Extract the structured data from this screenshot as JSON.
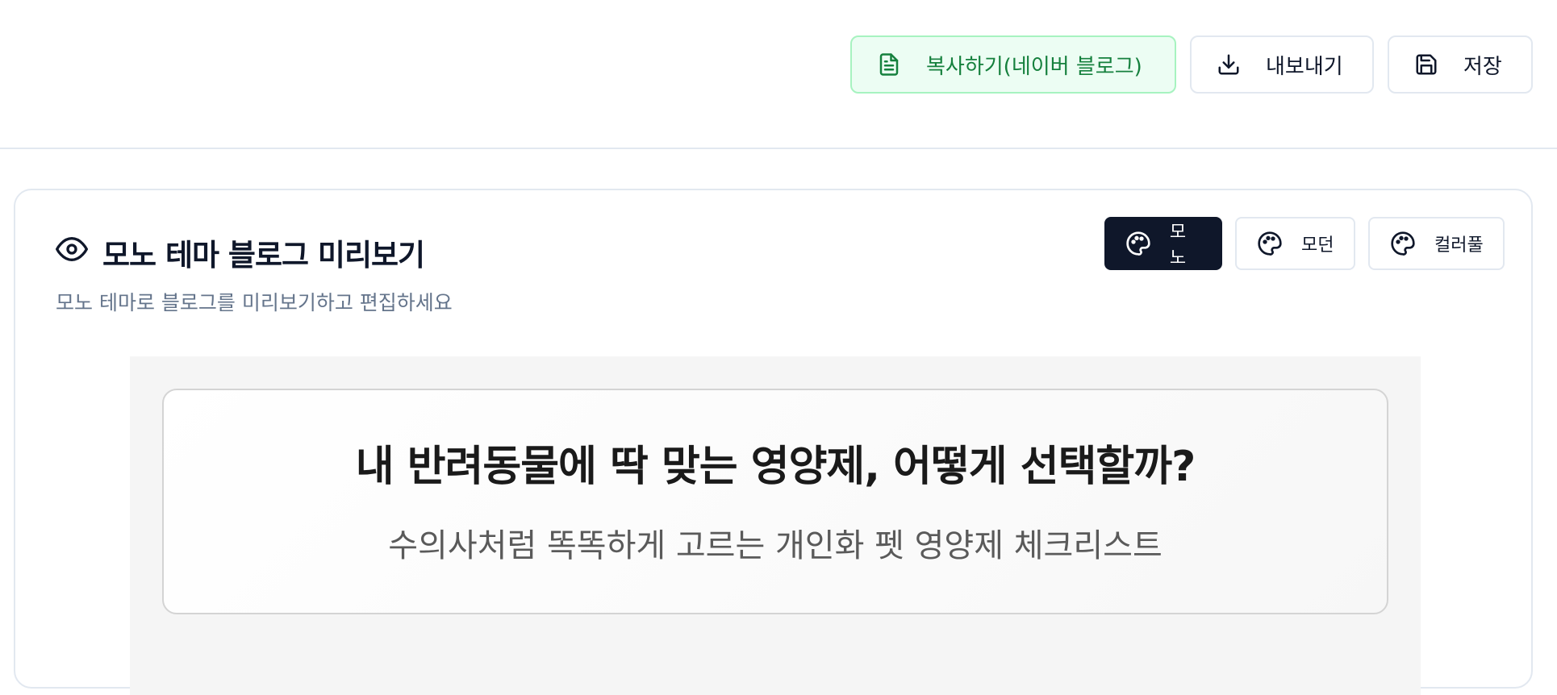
{
  "toolbar": {
    "copy_label": "복사하기(네이버 블로그)",
    "export_label": "내보내기",
    "save_label": "저장",
    "icons": {
      "copy": "file-text-icon",
      "export": "download-icon",
      "save": "save-icon"
    }
  },
  "card": {
    "title": "모노 테마 블로그 미리보기",
    "subtitle": "모노 테마로 블로그를 미리보기하고 편집하세요",
    "title_icon": "eye-icon",
    "themes": [
      {
        "label": "모노",
        "icon": "palette-icon",
        "active": true
      },
      {
        "label": "모던",
        "icon": "palette-icon",
        "active": false
      },
      {
        "label": "컬러풀",
        "icon": "palette-icon",
        "active": false
      }
    ]
  },
  "preview": {
    "title": "내 반려동물에 딱 맞는 영양제, 어떻게 선택할까?",
    "subtitle": "수의사처럼 똑똑하게 고르는 개인화 펫 영양제 체크리스트"
  },
  "colors": {
    "copy_green": "#15803d",
    "copy_bg": "#ecfdf3",
    "active_theme_bg": "#0f172a",
    "muted_text": "#64748b"
  }
}
